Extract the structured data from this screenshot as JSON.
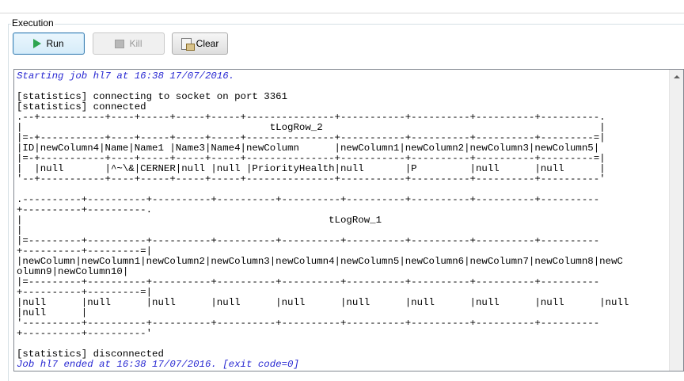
{
  "section": {
    "title": "Execution"
  },
  "toolbar": {
    "run_label": "Run",
    "kill_label": "Kill",
    "clear_label": "Clear"
  },
  "icons": {
    "run": "play-icon",
    "kill": "stop-icon",
    "clear": "clear-console-icon",
    "scroll_up": "chevron-up-icon"
  },
  "colors": {
    "info_text": "#2828d2",
    "run_icon": "#2ea44f",
    "disabled_text": "#9a9a9a"
  },
  "console": {
    "lines": [
      {
        "text": "Starting job hl7 at 16:38 17/07/2016.",
        "style": "info"
      },
      {
        "text": "",
        "style": "normal"
      },
      {
        "text": "[statistics] connecting to socket on port 3361",
        "style": "normal"
      },
      {
        "text": "[statistics] connected",
        "style": "normal"
      },
      {
        "text": ".--+-----------+----+-----+-----+-----+---------------+-----------+----------+----------+----------.",
        "style": "normal"
      },
      {
        "text": "|                                          tLogRow_2                                               |",
        "style": "normal"
      },
      {
        "text": "|=-+-----------+----+-----+-----+-----+---------------+-----------+----------+----------+---------=|",
        "style": "normal"
      },
      {
        "text": "|ID|newColumn4|Name|Name1 |Name3|Name4|newColumn      |newColumn1|newColumn2|newColumn3|newColumn5|",
        "style": "normal"
      },
      {
        "text": "|=-+-----------+----+-----+-----+-----+---------------+-----------+----------+----------+---------=|",
        "style": "normal"
      },
      {
        "text": "|  |null       |^~\\&|CERNER|null |null |PriorityHealth|null       |P         |null      |null      |",
        "style": "normal"
      },
      {
        "text": "'--+-----------+----+-----+-----+-----+---------------+-----------+----------+----------+----------'",
        "style": "normal"
      },
      {
        "text": "",
        "style": "normal"
      },
      {
        "text": ".----------+----------+----------+----------+----------+----------+----------+----------+----------",
        "style": "normal"
      },
      {
        "text": "+----------+----------.",
        "style": "normal"
      },
      {
        "text": "|                                                    tLogRow_1",
        "style": "normal"
      },
      {
        "text": "|",
        "style": "normal"
      },
      {
        "text": "|=---------+----------+----------+----------+----------+----------+----------+----------+----------",
        "style": "normal"
      },
      {
        "text": "+----------+---------=|",
        "style": "normal"
      },
      {
        "text": "|newColumn|newColumn1|newColumn2|newColumn3|newColumn4|newColumn5|newColumn6|newColumn7|newColumn8|newC",
        "style": "normal"
      },
      {
        "text": "olumn9|newColumn10|",
        "style": "normal"
      },
      {
        "text": "|=---------+----------+----------+----------+----------+----------+----------+----------+----------",
        "style": "normal"
      },
      {
        "text": "+----------+---------=|",
        "style": "normal"
      },
      {
        "text": "|null      |null      |null      |null      |null      |null      |null      |null      |null      |null",
        "style": "normal"
      },
      {
        "text": "|null      |",
        "style": "normal"
      },
      {
        "text": "'----------+----------+----------+----------+----------+----------+----------+----------+----------",
        "style": "normal"
      },
      {
        "text": "+----------+----------'",
        "style": "normal"
      },
      {
        "text": "",
        "style": "normal"
      },
      {
        "text": "[statistics] disconnected",
        "style": "normal"
      },
      {
        "text": "Job hl7 ended at 16:38 17/07/2016. [exit code=0]",
        "style": "info"
      }
    ]
  }
}
